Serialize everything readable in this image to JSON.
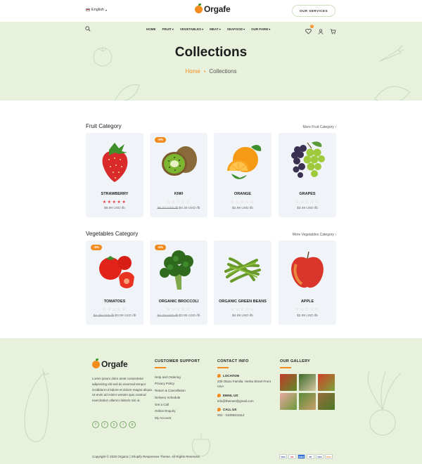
{
  "header": {
    "language": "English",
    "logo_text": "Orgafe",
    "services_button": "OUR SERVICES"
  },
  "nav": {
    "items": [
      "HOME",
      "FRUIT",
      "VEGETABLES",
      "MEAT",
      "SEAFOOD",
      "OUR FARM"
    ],
    "cart_count": "0"
  },
  "hero": {
    "title": "Collections",
    "breadcrumb_home": "Home",
    "breadcrumb_current": "Collections"
  },
  "fruit_section": {
    "title": "Fruit Category",
    "more": "More Fruit Category",
    "products": [
      {
        "name": "STRAWBERRY",
        "old_price": "",
        "price": "$8.99 USD /lb",
        "sale": "",
        "rating": 5
      },
      {
        "name": "KIWI",
        "old_price": "$6.20 USD /lb",
        "price": "$4.35 USD /lb",
        "sale": "-5%",
        "rating": 0
      },
      {
        "name": "ORANGE",
        "old_price": "",
        "price": "$2.99 USD /lb",
        "sale": "",
        "rating": 0
      },
      {
        "name": "GRAPES",
        "old_price": "",
        "price": "$3.49 USD /lb",
        "sale": "",
        "rating": 0
      }
    ]
  },
  "veg_section": {
    "title": "Vegetables Category",
    "more": "More Vegetables Category",
    "products": [
      {
        "name": "TOMATOES",
        "old_price": "$4.29 USD /lb",
        "price": "$3.99 USD /lb",
        "sale": "-6%",
        "rating": 0
      },
      {
        "name": "ORGANIC BROCCOLI",
        "old_price": "$4.20 USD /lb",
        "price": "$3.95 USD /lb",
        "sale": "-6%",
        "rating": 0
      },
      {
        "name": "ORGANIC GREEN BEANS",
        "old_price": "",
        "price": "$4.99 USD /lb",
        "sale": "",
        "rating": 0
      },
      {
        "name": "APPLE",
        "old_price": "",
        "price": "$2.99 USD /lb",
        "sale": "",
        "rating": 0
      }
    ]
  },
  "footer": {
    "logo_text": "Orgafe",
    "about": "Lorem ipsum dolor amet consectetur adipisicing elit sed do eiusmod tempor incididunt ut labore et dolore magna aliqua. Ut enim ad minim veniam quis nostrud exercitation ullamco laboris nisi ut.",
    "socials": [
      "f",
      "t",
      "y",
      "i",
      "p"
    ],
    "support_title": "CUSTOMER SUPPORT",
    "support_links": [
      "Help and Ordering",
      "Privacy Policy",
      "Return & Cancellation",
      "Delivery Schedule",
      "Get a Call",
      "Online Enquiry",
      "My Account"
    ],
    "contact_title": "CONTACT INFO",
    "location_label": "LOCATION",
    "location_value": "205 Olazu Familia, Herba Street Front USA",
    "email_label": "EMAIL US",
    "email_value": "info@themes@gmail.com",
    "call_label": "CALL US",
    "call_value": "002 - 01008431112",
    "gallery_title": "OUR GALLERY",
    "copyright": "Copyright © 2020 Organic | Shopify Responsive Theme. All Rights Reserved.",
    "payments": [
      "VISA",
      "MC",
      "AMEX",
      "PP",
      "VISA",
      "DISC"
    ]
  },
  "colors": {
    "accent": "#f28c1e",
    "hero_bg": "#e7f1dc",
    "card_bg": "#f0f4f8",
    "star_red": "#e53935"
  }
}
